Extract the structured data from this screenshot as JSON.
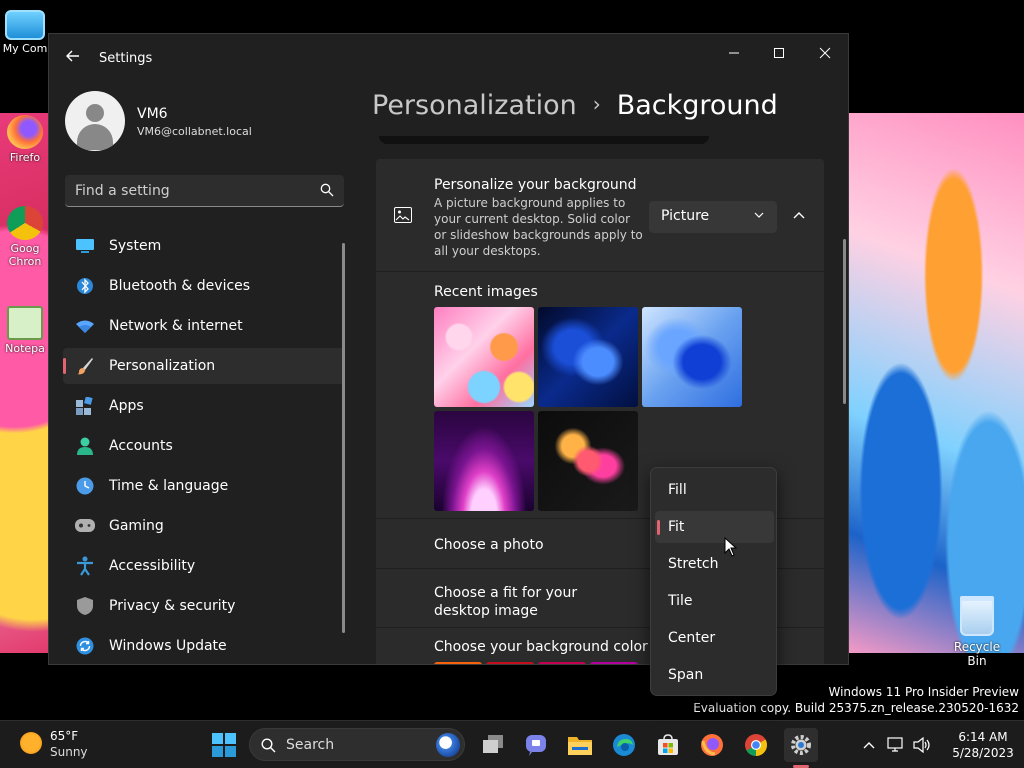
{
  "desktop": {
    "icons": [
      {
        "label": "My Com"
      },
      {
        "label": "Firefo"
      },
      {
        "label": "Goog Chron"
      },
      {
        "label": "Notepa"
      }
    ],
    "recycle_bin": "Recycle Bin",
    "watermark": {
      "line1": "Windows 11 Pro Insider Preview",
      "line2": "Evaluation copy. Build 25375.zn_release.230520-1632"
    }
  },
  "window": {
    "title": "Settings",
    "controls": {
      "minimize": "─",
      "maximize": "☐",
      "close": "✕"
    }
  },
  "profile": {
    "name": "VM6",
    "email": "VM6@collabnet.local"
  },
  "search": {
    "placeholder": "Find a setting"
  },
  "sidebar": {
    "items": [
      {
        "label": "System",
        "icon": "system-icon",
        "color": "#4cc2ff"
      },
      {
        "label": "Bluetooth & devices",
        "icon": "bluetooth-icon",
        "color": "#2b88d8"
      },
      {
        "label": "Network & internet",
        "icon": "wifi-icon",
        "color": "#58a6ff"
      },
      {
        "label": "Personalization",
        "icon": "brush-icon",
        "color": "#f0a060",
        "active": true
      },
      {
        "label": "Apps",
        "icon": "apps-icon",
        "color": "#9ab8d8"
      },
      {
        "label": "Accounts",
        "icon": "accounts-icon",
        "color": "#3ccfa3"
      },
      {
        "label": "Time & language",
        "icon": "time-language-icon",
        "color": "#4c9be8"
      },
      {
        "label": "Gaming",
        "icon": "gaming-icon",
        "color": "#b0b0b0"
      },
      {
        "label": "Accessibility",
        "icon": "accessibility-icon",
        "color": "#3a9ad9"
      },
      {
        "label": "Privacy & security",
        "icon": "shield-icon",
        "color": "#9a9a9a"
      },
      {
        "label": "Windows Update",
        "icon": "windows-update-icon",
        "color": "#2f8fe0"
      }
    ]
  },
  "breadcrumb": {
    "parent": "Personalization",
    "separator": "›",
    "current": "Background"
  },
  "background_card": {
    "title": "Personalize your background",
    "description": "A picture background applies to your current desktop. Solid color or slideshow backgrounds apply to all your desktops.",
    "dropdown_value": "Picture",
    "recent_images_title": "Recent images",
    "choose_photo_label": "Choose a photo",
    "choose_fit_label": "Choose a fit for your desktop image",
    "choose_color_label": "Choose your background color",
    "swatch_colors": [
      "#f7630c",
      "#c50f1f",
      "#c30052",
      "#b4009e"
    ]
  },
  "fit_menu": {
    "options": [
      "Fill",
      "Fit",
      "Stretch",
      "Tile",
      "Center",
      "Span"
    ],
    "selected": "Fit"
  },
  "taskbar": {
    "weather_temp": "65°F",
    "weather_desc": "Sunny",
    "search_label": "Search",
    "apps": [
      "start-icon",
      "task-view-icon",
      "teams-chat-icon",
      "file-explorer-icon",
      "edge-icon",
      "store-icon",
      "firefox-icon",
      "chrome-icon",
      "settings-icon"
    ],
    "clock_time": "6:14 AM",
    "clock_date": "5/28/2023"
  }
}
